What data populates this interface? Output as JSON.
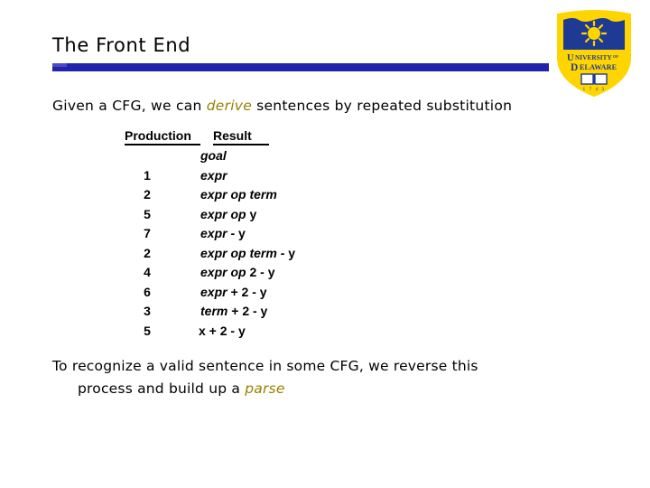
{
  "slide": {
    "title": "The Front End",
    "accent_color": "#2222aa",
    "emphasis_color": "#998000",
    "lead": {
      "before": "Given a CFG, we can ",
      "emphasis": "derive",
      "after": " sentences by repeated substitution"
    },
    "table": {
      "headers": {
        "production": "Production",
        "result": "Result"
      },
      "rows": [
        {
          "production": "",
          "result": "goal",
          "result_parts": [
            {
              "text": "goal",
              "kind": "nonterminal"
            }
          ]
        },
        {
          "production": "1",
          "result": "expr",
          "result_parts": [
            {
              "text": "expr",
              "kind": "nonterminal"
            }
          ]
        },
        {
          "production": "2",
          "result": "expr op term",
          "result_parts": [
            {
              "text": "expr op term",
              "kind": "nonterminal"
            }
          ]
        },
        {
          "production": "5",
          "result": "expr op y",
          "result_parts": [
            {
              "text": "expr op ",
              "kind": "nonterminal"
            },
            {
              "text": "y",
              "kind": "terminal"
            }
          ]
        },
        {
          "production": "7",
          "result": "expr - y",
          "result_parts": [
            {
              "text": "expr",
              "kind": "nonterminal"
            },
            {
              "text": " - y",
              "kind": "terminal"
            }
          ]
        },
        {
          "production": "2",
          "result": "expr op term - y",
          "result_parts": [
            {
              "text": "expr op term",
              "kind": "nonterminal"
            },
            {
              "text": " - y",
              "kind": "terminal"
            }
          ]
        },
        {
          "production": "4",
          "result": "expr op 2 - y",
          "result_parts": [
            {
              "text": "expr op ",
              "kind": "nonterminal"
            },
            {
              "text": "2 - y",
              "kind": "terminal"
            }
          ]
        },
        {
          "production": "6",
          "result": "expr + 2 - y",
          "result_parts": [
            {
              "text": "expr",
              "kind": "nonterminal"
            },
            {
              "text": " + 2 - y",
              "kind": "terminal"
            }
          ]
        },
        {
          "production": "3",
          "result": "term + 2 - y",
          "result_parts": [
            {
              "text": "term",
              "kind": "nonterminal"
            },
            {
              "text": " + 2 - y",
              "kind": "terminal"
            }
          ]
        },
        {
          "production": "5",
          "result": "x + 2 - y",
          "result_parts": [
            {
              "text": "x + 2 - y",
              "kind": "terminal"
            }
          ]
        }
      ]
    },
    "closing": {
      "line1": "To recognize a valid sentence in some CFG, we reverse this",
      "line2_before": "process and build up a ",
      "line2_emphasis": "parse"
    }
  },
  "logo": {
    "name": "university-of-delaware-shield",
    "institution_line1": "UNIVERSITY",
    "institution_of": "OF",
    "institution_line2": "DELAWARE",
    "founded": "1 7 4 3",
    "shield_blue": "#1f3a93",
    "shield_gold": "#ffd500"
  }
}
